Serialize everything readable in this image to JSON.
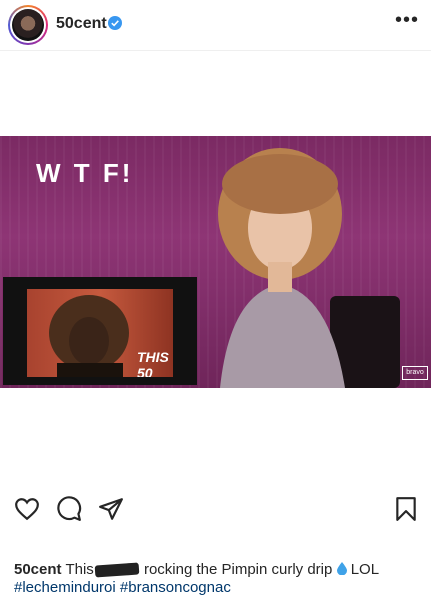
{
  "header": {
    "username": "50cent",
    "avatar_icon": "profile-avatar",
    "verified_icon": "verified-badge-icon",
    "more_icon": "more-options-icon",
    "more_label": "•••"
  },
  "media": {
    "overlay_text": "W T F!",
    "pip_logo": "THIS 50",
    "network_bug": "bravo"
  },
  "actions": {
    "like_icon": "heart-icon",
    "comment_icon": "comment-icon",
    "share_icon": "send-icon",
    "save_icon": "bookmark-icon"
  },
  "caption": {
    "username": "50cent",
    "text_before": "This",
    "text_after": " rocking the Pimpin curly drip",
    "emoji": "droplet-icon",
    "text_end": " LOL",
    "hashtag_1": "#lecheminduroi",
    "hashtag_2": "#bransoncognac"
  },
  "colors": {
    "text": "#262626",
    "link": "#00376b",
    "verified": "#3897f0",
    "media_bg": "#7b2a63"
  }
}
